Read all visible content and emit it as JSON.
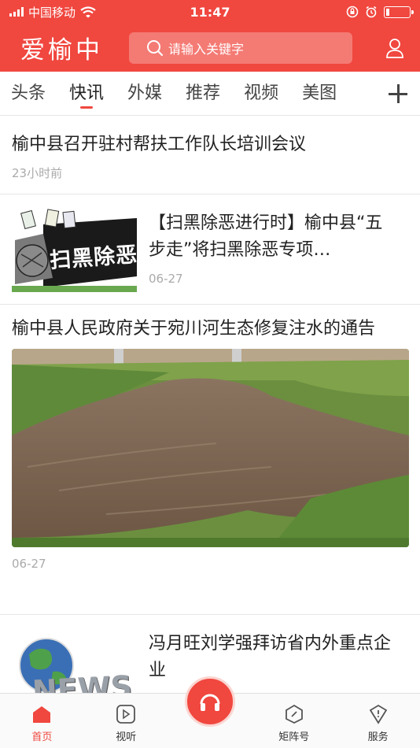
{
  "status_bar": {
    "carrier": "中国移动",
    "time": "11:47"
  },
  "header": {
    "logo": "爱榆中",
    "search_placeholder": "请输入关键字",
    "icons": [
      "search-icon",
      "user-icon"
    ]
  },
  "tabs": [
    {
      "label": "头条",
      "active": false
    },
    {
      "label": "快讯",
      "active": true
    },
    {
      "label": "外媒",
      "active": false
    },
    {
      "label": "推荐",
      "active": false
    },
    {
      "label": "视频",
      "active": false
    },
    {
      "label": "美图",
      "active": false
    }
  ],
  "feed": [
    {
      "title": "榆中县召开驻村帮扶工作队长培训会议",
      "meta": "23小时前"
    },
    {
      "title": "【扫黑除恶进行时】榆中县“五步走”将扫黑除恶专项…",
      "meta": "06-27",
      "thumb_text": "扫黑除恶"
    },
    {
      "title": "榆中县人民政府关于宛川河生态修复注水的通告",
      "meta": "06-27"
    },
    {
      "title": "冯月旺刘学强拜访省内外重点企业",
      "thumb_text": "NEWS"
    }
  ],
  "bottom_nav": [
    {
      "label": "首页",
      "icon": "home-icon",
      "active": true
    },
    {
      "label": "视听",
      "icon": "play-icon",
      "active": false
    },
    {
      "label": "",
      "icon": "headphone-icon",
      "active": false
    },
    {
      "label": "矩阵号",
      "icon": "compass-icon",
      "active": false
    },
    {
      "label": "服务",
      "icon": "shield-icon",
      "active": false
    }
  ],
  "colors": {
    "brand": "#f0473f",
    "text": "#222222",
    "meta": "#aaaaaa"
  }
}
